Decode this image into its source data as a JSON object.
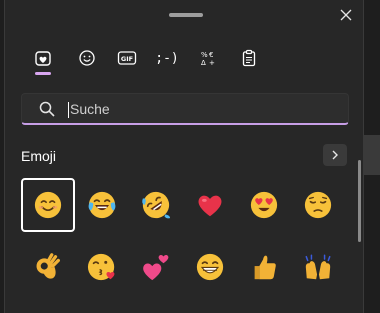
{
  "search": {
    "placeholder": "Suche"
  },
  "section": {
    "title": "Emoji"
  },
  "tabs": [
    {
      "icon": "heart-smiley-icon",
      "selected": true
    },
    {
      "icon": "smiley-icon"
    },
    {
      "icon": "gif-icon",
      "label": "GIF"
    },
    {
      "icon": "kaomoji-icon",
      "label": ";-)"
    },
    {
      "icon": "symbols-icon"
    },
    {
      "icon": "clipboard-icon"
    }
  ],
  "emojis": [
    {
      "name": "smiling-face",
      "selected": true
    },
    {
      "name": "face-with-tears-of-joy"
    },
    {
      "name": "rolling-on-the-floor-laughing"
    },
    {
      "name": "red-heart"
    },
    {
      "name": "smiling-face-with-heart-eyes"
    },
    {
      "name": "pensive-face"
    },
    {
      "name": "ok-hand"
    },
    {
      "name": "face-blowing-a-kiss"
    },
    {
      "name": "two-hearts"
    },
    {
      "name": "grinning-face"
    },
    {
      "name": "thumbs-up"
    },
    {
      "name": "raising-hands"
    }
  ],
  "colors": {
    "accent": "#c79ee6",
    "panel": "#272727",
    "emoji_yellow": "#f7c13a"
  }
}
